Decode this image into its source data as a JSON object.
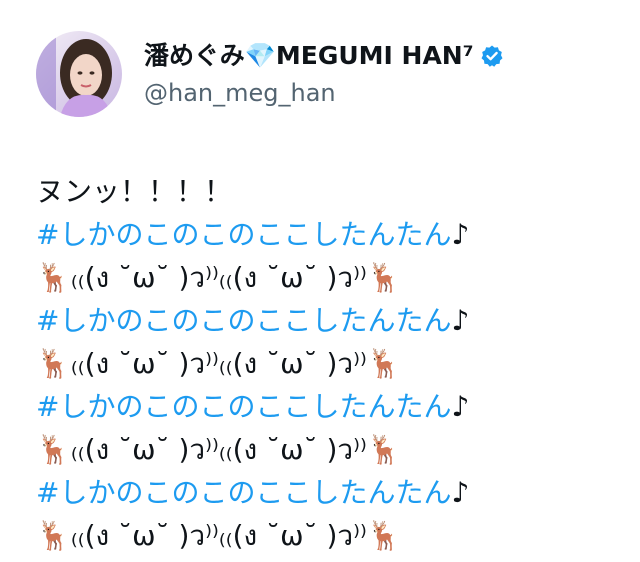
{
  "author": {
    "display_name": "潘めぐみ💎MEGUMI HAN⁷",
    "handle": "@han_meg_han",
    "verified": true
  },
  "tweet": {
    "lines": [
      {
        "type": "text",
        "text": "ヌンッ！！！！"
      },
      {
        "type": "hashtag",
        "text": "#しかのこのこのここしたんたん",
        "suffix": "♪"
      },
      {
        "type": "text",
        "text": "🦌₍₍(ง ˘ω˘ )ว⁾⁾₍₍(ง ˘ω˘ )ว⁾⁾🦌"
      },
      {
        "type": "hashtag",
        "text": "#しかのこのこのここしたんたん",
        "suffix": "♪"
      },
      {
        "type": "text",
        "text": "🦌₍₍(ง ˘ω˘ )ว⁾⁾₍₍(ง ˘ω˘ )ว⁾⁾🦌"
      },
      {
        "type": "hashtag",
        "text": "#しかのこのこのここしたんたん",
        "suffix": "♪"
      },
      {
        "type": "text",
        "text": "🦌₍₍(ง ˘ω˘ )ว⁾⁾₍₍(ง ˘ω˘ )ว⁾⁾🦌"
      },
      {
        "type": "hashtag",
        "text": "#しかのこのこのここしたんたん",
        "suffix": "♪"
      },
      {
        "type": "text",
        "text": "🦌₍₍(ง ˘ω˘ )ว⁾⁾₍₍(ง ˘ω˘ )ว⁾⁾🦌"
      }
    ]
  },
  "colors": {
    "hashtag": "#1d9bf0",
    "verified_badge": "#1d9bf0",
    "text": "#0f1419",
    "handle": "#536471"
  },
  "icons": {
    "verified": "verified-badge-icon",
    "avatar": "profile-photo"
  }
}
